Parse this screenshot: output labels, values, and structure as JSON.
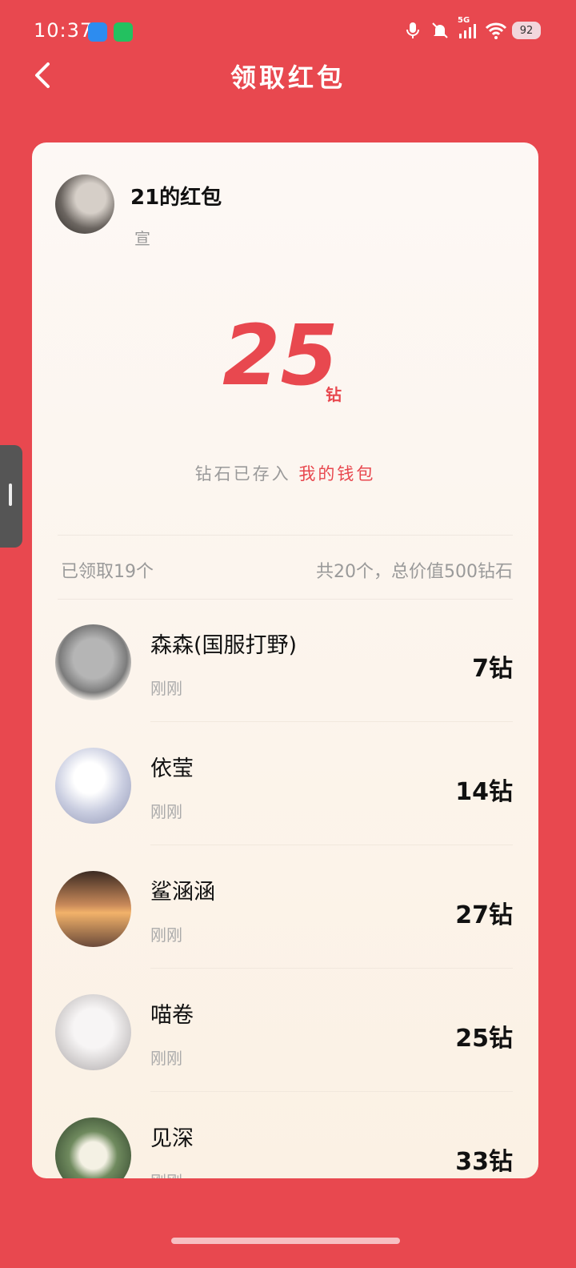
{
  "status_bar": {
    "time": "10:37",
    "signal_label": "5G",
    "battery": "92"
  },
  "header": {
    "title": "领取红包"
  },
  "packet": {
    "sender_title": "21的红包",
    "message": "宣",
    "amount": "25",
    "unit": "钻",
    "saved_prefix": "钻石已存入",
    "wallet_link": "我的钱包",
    "claimed_summary": "已领取19个",
    "total_summary": "共20个，总价值500钻石"
  },
  "records": [
    {
      "name": "森森(国服打野)",
      "time": "刚刚",
      "amount": "7钻",
      "avatar_color": "#8f8f8f"
    },
    {
      "name": "依莹",
      "time": "刚刚",
      "amount": "14钻",
      "avatar_color": "#c9cde0"
    },
    {
      "name": "鲨涵涵",
      "time": "刚刚",
      "amount": "27钻",
      "avatar_color": "#c98a5a"
    },
    {
      "name": "喵卷",
      "time": "刚刚",
      "amount": "25钻",
      "avatar_color": "#d9d6d6"
    },
    {
      "name": "见深",
      "time": "刚刚",
      "amount": "33钻",
      "avatar_color": "#3f5a3a"
    }
  ],
  "colors": {
    "brand_red": "#E8484F",
    "card_bg": "#FDF8F5"
  }
}
